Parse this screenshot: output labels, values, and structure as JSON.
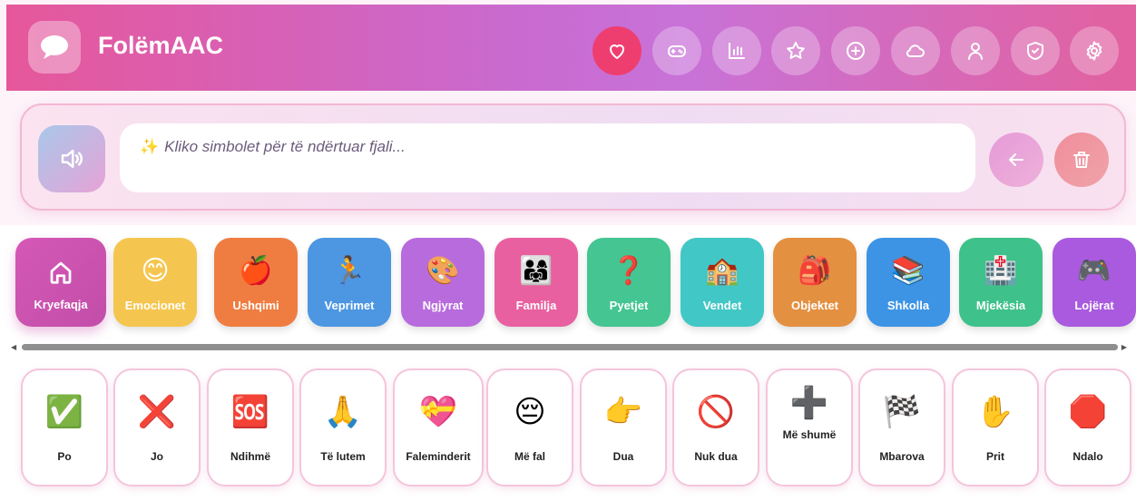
{
  "app": {
    "title": "FolëmAAC"
  },
  "header_buttons": [
    {
      "name": "favorites-button",
      "icon": "heart-icon",
      "active": true
    },
    {
      "name": "games-button",
      "icon": "gamepad-icon"
    },
    {
      "name": "stats-button",
      "icon": "bar-chart-icon"
    },
    {
      "name": "star-button",
      "icon": "star-icon"
    },
    {
      "name": "add-button",
      "icon": "plus-circle-icon"
    },
    {
      "name": "cloud-button",
      "icon": "cloud-icon"
    },
    {
      "name": "profile-button",
      "icon": "user-icon"
    },
    {
      "name": "shield-button",
      "icon": "shield-check-icon"
    },
    {
      "name": "settings-button",
      "icon": "gear-icon"
    }
  ],
  "sentence": {
    "placeholder": "Kliko simbolet për të ndërtuar fjali..."
  },
  "categories": [
    {
      "label": "Kryefaqja",
      "color": "#d153b2",
      "icon": "home-icon"
    },
    {
      "label": "Emocionet",
      "color": "#f5c64f",
      "icon": "😊"
    },
    {
      "label": "Ushqimi",
      "color": "#ef7d41",
      "icon": "🍎"
    },
    {
      "label": "Veprimet",
      "color": "#4c96e2",
      "icon": "🏃"
    },
    {
      "label": "Ngjyrat",
      "color": "#b86bdc",
      "icon": "🎨"
    },
    {
      "label": "Familja",
      "color": "#e8609f",
      "icon": "👨‍👩‍👧"
    },
    {
      "label": "Pyetjet",
      "color": "#44c591",
      "icon": "❓"
    },
    {
      "label": "Vendet",
      "color": "#41c7c5",
      "icon": "🏫"
    },
    {
      "label": "Objektet",
      "color": "#e49041",
      "icon": "🎒"
    },
    {
      "label": "Shkolla",
      "color": "#3d94e5",
      "icon": "📚"
    },
    {
      "label": "Mjekësia",
      "color": "#3ec18a",
      "icon": "🏥"
    },
    {
      "label": "Lojërat",
      "color": "#a95adf",
      "icon": "🎮"
    }
  ],
  "words": [
    {
      "label": "Po",
      "icon": "✅"
    },
    {
      "label": "Jo",
      "icon": "❌"
    },
    {
      "label": "Ndihmë",
      "icon": "🆘"
    },
    {
      "label": "Të lutem",
      "icon": "🙏"
    },
    {
      "label": "Faleminderit",
      "icon": "💝"
    },
    {
      "label": "Më fal",
      "icon": "😔"
    },
    {
      "label": "Dua",
      "icon": "👉"
    },
    {
      "label": "Nuk dua",
      "icon": "🚫"
    },
    {
      "label": "Më shumë",
      "icon": "➕"
    },
    {
      "label": "Mbarova",
      "icon": "🏁"
    },
    {
      "label": "Prit",
      "icon": "✋"
    },
    {
      "label": "Ndalo",
      "icon": "🛑"
    }
  ]
}
